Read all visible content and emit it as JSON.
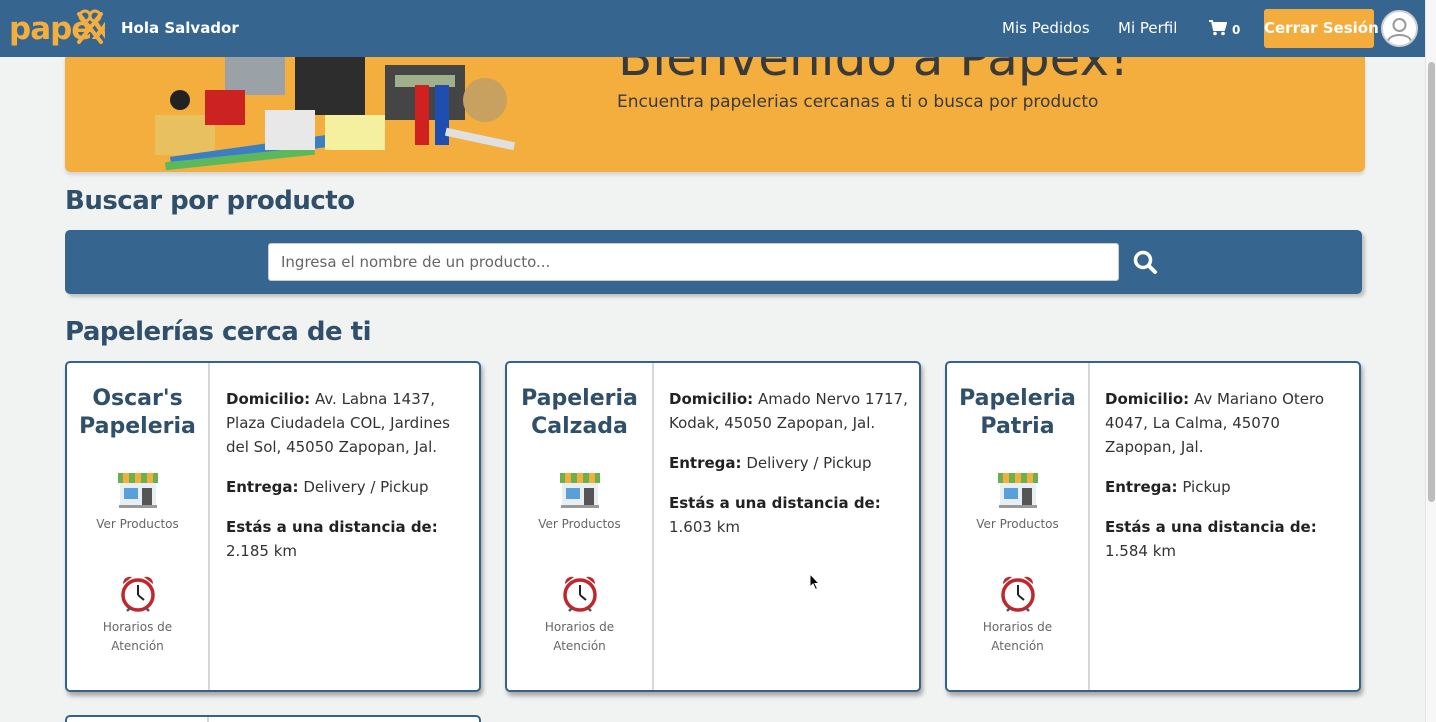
{
  "nav": {
    "logo_text": "papex",
    "greeting": "Hola Salvador",
    "links": [
      "Mis Pedidos",
      "Mi Perfil"
    ],
    "cart_count": "0",
    "logout_label": "Cerrar Sesión"
  },
  "hero": {
    "title": "Bienvenido a Papex!",
    "subtitle": "Encuentra papelerias cercanas a ti o busca por producto"
  },
  "search": {
    "title": "Buscar por producto",
    "placeholder": "Ingresa el nombre de un producto..."
  },
  "stores_title": "Papelerías cerca de ti",
  "labels": {
    "address": "Domicilio:",
    "delivery": "Entrega:",
    "distance": "Estás a una distancia de:",
    "ver_productos": "Ver Productos",
    "horarios": "Horarios de Atención"
  },
  "stores": [
    {
      "name": "Oscar's Papeleria",
      "address": "Av. Labna 1437, Plaza Ciudadela COL, Jardines del Sol, 45050 Zapopan, Jal.",
      "delivery": "Delivery / Pickup",
      "distance": "2.185 km"
    },
    {
      "name": "Papeleria Calzada",
      "address": "Amado Nervo 1717, Kodak, 45050 Zapopan, Jal.",
      "delivery": "Delivery / Pickup",
      "distance": "1.603 km"
    },
    {
      "name": "Papeleria Patria",
      "address": "Av Mariano Otero 4047, La Calma, 45070 Zapopan, Jal.",
      "delivery": "Pickup",
      "distance": "1.584 km"
    }
  ],
  "colors": {
    "navbar": "#366590",
    "accent": "#f4ae3e",
    "heading": "#2f4f6a",
    "card_border": "#34628c"
  },
  "icons": [
    "cart-icon",
    "search-icon",
    "store-icon",
    "alarm-clock-icon",
    "user-avatar-icon"
  ]
}
